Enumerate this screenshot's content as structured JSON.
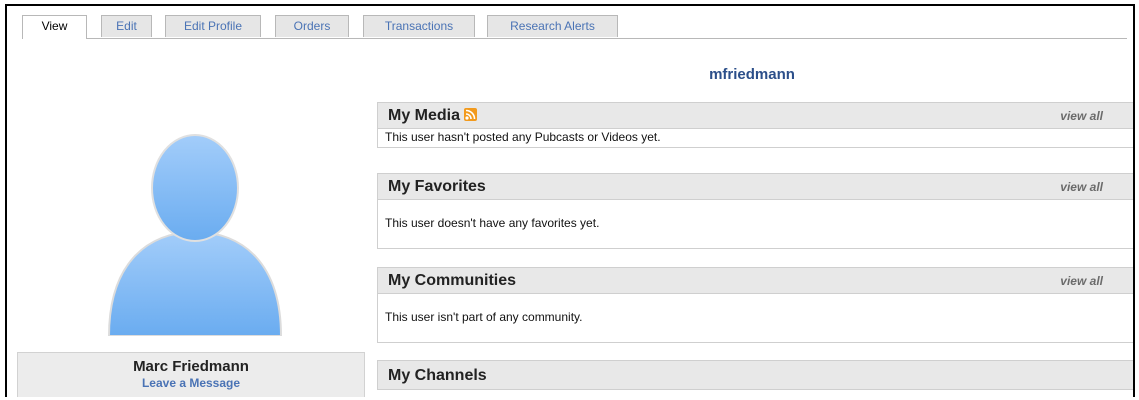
{
  "tabs": [
    {
      "label": "View",
      "active": true
    },
    {
      "label": "Edit"
    },
    {
      "label": "Edit Profile"
    },
    {
      "label": "Orders"
    },
    {
      "label": "Transactions"
    },
    {
      "label": "Research Alerts"
    }
  ],
  "username": "mfriedmann",
  "profile": {
    "name": "Marc Friedmann",
    "leave_message": "Leave a Message"
  },
  "sections": {
    "media": {
      "title": "My Media",
      "view_all": "view all",
      "body": "This user hasn't posted any Pubcasts or Videos yet.",
      "icon": "rss-icon"
    },
    "favorites": {
      "title": "My Favorites",
      "view_all": "view all",
      "body": "This user doesn't have any favorites yet."
    },
    "communities": {
      "title": "My Communities",
      "view_all": "view all",
      "body": "This user isn't part of any community."
    },
    "channels": {
      "title": "My Channels"
    }
  },
  "colors": {
    "link": "#4a73b5",
    "username": "#2c4f8a",
    "header_bg": "#e8e8e8",
    "avatar": "#6aacf0"
  }
}
